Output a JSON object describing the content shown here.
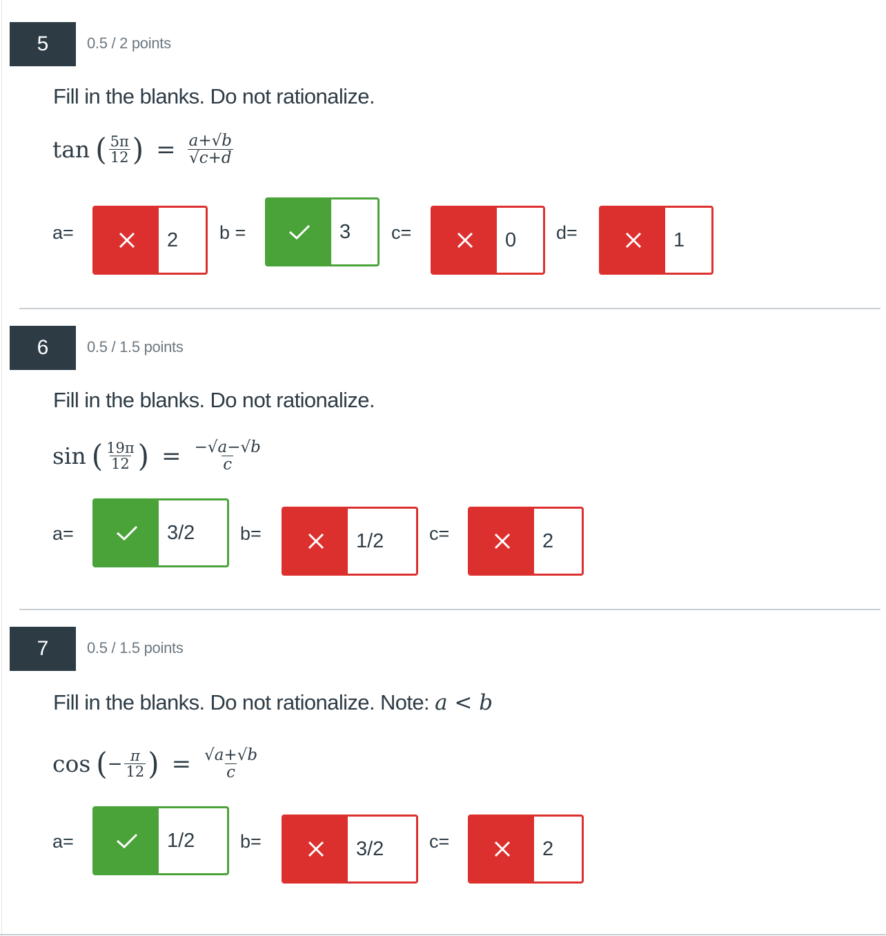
{
  "questions": [
    {
      "number": "5",
      "points": "0.5 / 2 points",
      "prompt": "Fill in the blanks. Do not rationalize.",
      "equation": {
        "fn": "tan",
        "arg_num": "5π",
        "arg_den": "12",
        "rhs_num": "a+√b",
        "rhs_den": "√c+d"
      },
      "answers": [
        {
          "label": "a=",
          "status": "incorrect",
          "value": "2"
        },
        {
          "label": "b =",
          "status": "correct",
          "value": "3"
        },
        {
          "label": "c=",
          "status": "incorrect",
          "value": "0"
        },
        {
          "label": "d=",
          "status": "incorrect",
          "value": "1"
        }
      ]
    },
    {
      "number": "6",
      "points": "0.5 / 1.5 points",
      "prompt": "Fill in the blanks. Do not rationalize.",
      "equation": {
        "fn": "sin",
        "arg_num": "19π",
        "arg_den": "12",
        "rhs_num": "−√a−√b",
        "rhs_den": "c"
      },
      "answers": [
        {
          "label": "a=",
          "status": "correct",
          "value": "3/2"
        },
        {
          "label": "b=",
          "status": "incorrect",
          "value": "1/2"
        },
        {
          "label": "c=",
          "status": "incorrect",
          "value": "2"
        }
      ]
    },
    {
      "number": "7",
      "points": "0.5 / 1.5 points",
      "prompt": "Fill in the blanks. Do not rationalize. Note:",
      "prompt_math": "a < b",
      "equation": {
        "fn": "cos",
        "arg_num": "π",
        "arg_den": "12",
        "rhs_num": "√a+√b",
        "rhs_den": "c"
      },
      "answers": [
        {
          "label": "a=",
          "status": "correct",
          "value": "1/2"
        },
        {
          "label": "b=",
          "status": "incorrect",
          "value": "3/2"
        },
        {
          "label": "c=",
          "status": "incorrect",
          "value": "2"
        }
      ]
    }
  ],
  "colors": {
    "correct": "#4aa339",
    "incorrect": "#dc302f",
    "badge": "#2d3b45"
  },
  "icons": {
    "correct": "check-icon",
    "incorrect": "x-icon"
  }
}
